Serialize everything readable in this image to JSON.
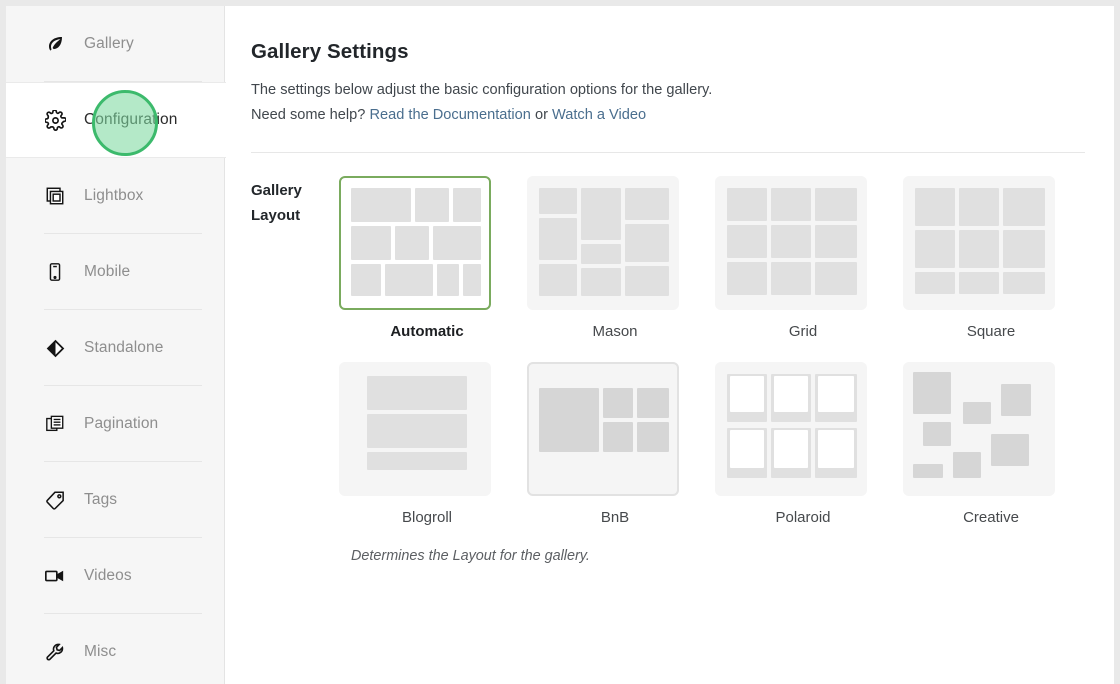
{
  "sidebar": {
    "items": [
      {
        "label": "Gallery",
        "icon": "leaf-icon",
        "active": false
      },
      {
        "label": "Configuration",
        "icon": "gear-icon",
        "active": true
      },
      {
        "label": "Lightbox",
        "icon": "lightbox-icon",
        "active": false
      },
      {
        "label": "Mobile",
        "icon": "mobile-icon",
        "active": false
      },
      {
        "label": "Standalone",
        "icon": "diamond-icon",
        "active": false
      },
      {
        "label": "Pagination",
        "icon": "pagination-icon",
        "active": false
      },
      {
        "label": "Tags",
        "icon": "tag-icon",
        "active": false
      },
      {
        "label": "Videos",
        "icon": "video-icon",
        "active": false
      },
      {
        "label": "Misc",
        "icon": "wrench-icon",
        "active": false
      }
    ]
  },
  "header": {
    "title": "Gallery Settings",
    "description_line1": "The settings below adjust the basic configuration options for the gallery.",
    "description_line2_prefix": "Need some help? ",
    "link_docs": "Read the Documentation",
    "link_separator": " or ",
    "link_video": "Watch a Video"
  },
  "layout_field": {
    "label_line1": "Gallery",
    "label_line2": "Layout",
    "note": "Determines the Layout for the gallery.",
    "selected": "Automatic",
    "options": [
      {
        "label": "Automatic",
        "thumb": "automatic",
        "selected": true,
        "hovered": false
      },
      {
        "label": "Mason",
        "thumb": "mason",
        "selected": false,
        "hovered": false
      },
      {
        "label": "Grid",
        "thumb": "grid",
        "selected": false,
        "hovered": false
      },
      {
        "label": "Square",
        "thumb": "square",
        "selected": false,
        "hovered": false
      },
      {
        "label": "Blogroll",
        "thumb": "blogroll",
        "selected": false,
        "hovered": false
      },
      {
        "label": "BnB",
        "thumb": "bnb",
        "selected": false,
        "hovered": true
      },
      {
        "label": "Polaroid",
        "thumb": "polaroid",
        "selected": false,
        "hovered": false
      },
      {
        "label": "Creative",
        "thumb": "creative",
        "selected": false,
        "hovered": false
      }
    ]
  },
  "highlight": {
    "target": "Configuration",
    "ring_color": "#3cba6c",
    "fill_color": "#7ed9a0"
  },
  "colors": {
    "accent_green": "#7aab5e",
    "link_blue": "#4a6e8e",
    "sidebar_bg": "#f6f6f6",
    "thumb_bg": "#f5f5f5",
    "cell_gray": "#e0e0e0"
  }
}
